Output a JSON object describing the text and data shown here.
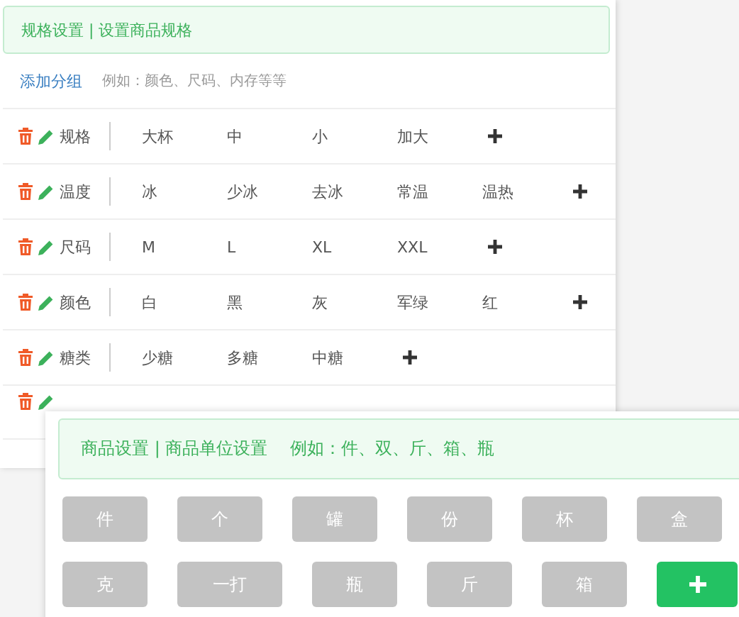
{
  "spec_panel": {
    "title": "规格设置 | 设置商品规格",
    "add_group_link": "添加分组",
    "add_group_hint": "例如：颜色、尺码、内存等等",
    "groups": [
      {
        "name": "规格",
        "values": [
          "大杯",
          "中",
          "小",
          "加大"
        ]
      },
      {
        "name": "温度",
        "values": [
          "冰",
          "少冰",
          "去冰",
          "常温",
          "温热"
        ]
      },
      {
        "name": "尺码",
        "values": [
          "M",
          "L",
          "XL",
          "XXL"
        ]
      },
      {
        "name": "颜色",
        "values": [
          "白",
          "黑",
          "灰",
          "军绿",
          "红"
        ]
      },
      {
        "name": "糖类",
        "values": [
          "少糖",
          "多糖",
          "中糖"
        ]
      }
    ],
    "covered_group": {
      "kind": "covered"
    }
  },
  "unit_panel": {
    "title": "商品设置 | 商品单位设置",
    "hint": "例如：件、双、斤、箱、瓶",
    "units": [
      "件",
      "个",
      "罐",
      "份",
      "杯",
      "盒",
      "克",
      "一打",
      "瓶",
      "斤",
      "箱"
    ]
  }
}
